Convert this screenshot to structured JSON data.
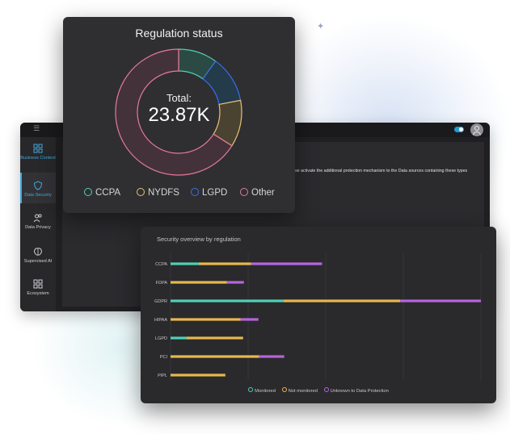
{
  "colors": {
    "monitored": "#4fd1b5",
    "not_monitored": "#e8b84d",
    "unknown": "#b664e0",
    "ccpa": "#4fd1b5",
    "nydfs": "#e8c270",
    "lgpd": "#3b6df0",
    "other": "#e77a98",
    "accent": "#3fa9dc"
  },
  "sidebar": {
    "items": [
      {
        "label": "Business Context",
        "icon": "dashboard-icon"
      },
      {
        "label": "Data Security",
        "icon": "shield-icon"
      },
      {
        "label": "Data Privacy",
        "icon": "users-icon"
      },
      {
        "label": "Supervised AI",
        "icon": "brain-icon"
      },
      {
        "label": "Ecosystem",
        "icon": "grid-icon"
      }
    ]
  },
  "content": {
    "info_text": "se activate the additional protection mechanism to the Data sources containing these types"
  },
  "regulation_status": {
    "title": "Regulation status",
    "total_label": "Total:",
    "total_value": "23.87K",
    "legend": [
      "CCPA",
      "NYDFS",
      "LGPD",
      "Other"
    ]
  },
  "security_overview": {
    "title": "Security overview by regulation",
    "legend": [
      "Monitored",
      "Not monitored",
      "Unknown to Data Protection"
    ]
  },
  "chart_data": [
    {
      "type": "pie",
      "title": "Regulation status",
      "labels": [
        "CCPA",
        "LGPD",
        "NYDFS",
        "Other"
      ],
      "values": [
        2.39,
        2.86,
        2.86,
        15.76
      ],
      "total": "23.87K"
    },
    {
      "type": "bar",
      "orientation": "horizontal",
      "stacked": true,
      "title": "Security overview by regulation",
      "categories": [
        "CCPA",
        "FDPA",
        "GDPR",
        "HIPAA",
        "LGPD",
        "PCI",
        "PIPL"
      ],
      "series": [
        {
          "name": "Monitored",
          "values": [
            35,
            0,
            140,
            0,
            20,
            0,
            0
          ]
        },
        {
          "name": "Not monitored",
          "values": [
            65,
            70,
            145,
            87,
            70,
            110,
            68
          ]
        },
        {
          "name": "Unknown to Data Protection",
          "values": [
            88,
            21,
            100,
            22,
            0,
            31,
            0
          ]
        }
      ],
      "xlim": [
        0,
        385
      ],
      "grid": true,
      "legend_position": "bottom"
    }
  ]
}
